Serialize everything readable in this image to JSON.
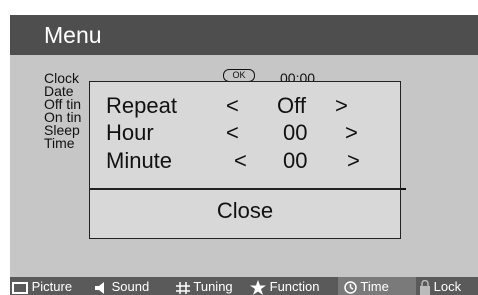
{
  "header": {
    "title": "Menu"
  },
  "background_items": [
    {
      "label": "Clock"
    },
    {
      "label": "Date"
    },
    {
      "label": "Off tin"
    },
    {
      "label": "On tin"
    },
    {
      "label": "Sleep"
    },
    {
      "label": "Time"
    }
  ],
  "background_ok": "OK",
  "background_value": "00:00",
  "dialog": {
    "rows": [
      {
        "label": "Repeat",
        "left_arrow": "<",
        "value": "Off",
        "right_arrow": ">"
      },
      {
        "label": "Hour",
        "left_arrow": "<",
        "value": "00",
        "right_arrow": ">"
      },
      {
        "label": "Minute",
        "left_arrow": "<",
        "value": "00",
        "right_arrow": ">"
      }
    ],
    "close_label": "Close"
  },
  "tabs": [
    {
      "label": "Picture",
      "icon": "picture-icon",
      "active": false
    },
    {
      "label": "Sound",
      "icon": "speaker-icon",
      "active": false
    },
    {
      "label": "Tuning",
      "icon": "grid-icon",
      "active": false
    },
    {
      "label": "Function",
      "icon": "star-icon",
      "active": false
    },
    {
      "label": "Time",
      "icon": "clock-icon",
      "active": true
    },
    {
      "label": "Lock",
      "icon": "lock-icon",
      "active": false
    }
  ],
  "colors": {
    "screen_bg": "#c6c6c6",
    "header_bg": "#4e4e4e",
    "tabbar_bg": "#5a5a5a",
    "active_tab_bg": "#7a7a7a"
  }
}
